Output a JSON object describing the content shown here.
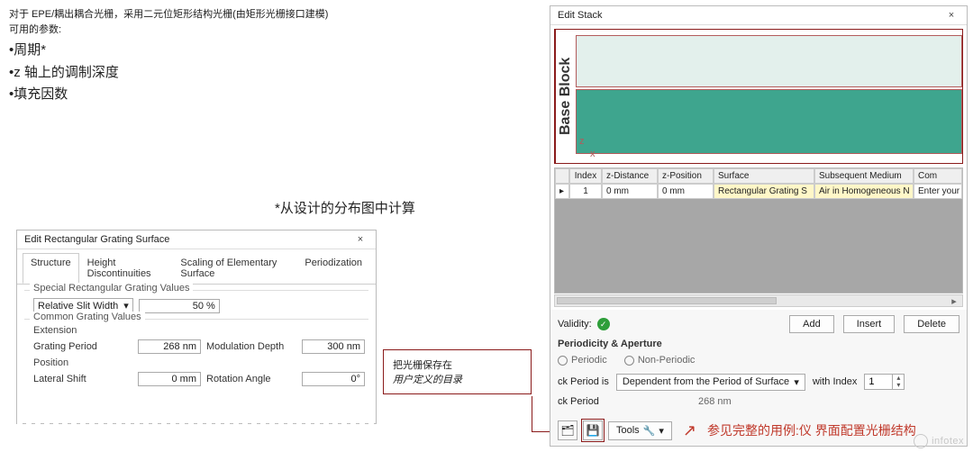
{
  "desc": {
    "p1": "对于 EPE/耦出耦合光栅，采用二元位矩形结构光栅(由矩形光栅接口建模)",
    "p2": "可用的参数:",
    "b1": "•周期*",
    "b2": "•z 轴上的调制深度",
    "b3": "•填充因数",
    "asterisk": "*从设计的分布图中计算"
  },
  "ergs": {
    "title": "Edit Rectangular Grating Surface",
    "close": "×",
    "tabs": {
      "structure": "Structure",
      "height": "Height Discontinuities",
      "scaling": "Scaling of Elementary Surface",
      "period": "Periodization"
    },
    "grp_special": "Special Rectangular Grating Values",
    "rel_slit_label": "Relative Slit Width",
    "rel_slit_val": "50 %",
    "grp_common": "Common Grating Values",
    "sub_ext": "Extension",
    "grating_period_label": "Grating Period",
    "grating_period_val": "268 nm",
    "mod_depth_label": "Modulation Depth",
    "mod_depth_val": "300 nm",
    "sub_pos": "Position",
    "lat_shift_label": "Lateral Shift",
    "lat_shift_val": "0 mm",
    "rot_angle_label": "Rotation Angle",
    "rot_angle_val": "0°"
  },
  "callout": {
    "l1": "把光栅保存在",
    "l2": "用户定义的目录"
  },
  "stack": {
    "title": "Edit Stack",
    "close": "×",
    "block_label": "Base Block",
    "axis_x": "x",
    "axis_z": "z",
    "grid": {
      "h_mark": "",
      "h_index": "Index",
      "h_zd": "z-Distance",
      "h_zp": "z-Position",
      "h_surf": "Surface",
      "h_med": "Subsequent Medium",
      "h_com": "Com",
      "r_mark": "▸",
      "r_index": "1",
      "r_zd": "0 mm",
      "r_zp": "0 mm",
      "r_surf": "Rectangular Grating S",
      "r_med": "Air in Homogeneous N",
      "r_com": "Enter your commen"
    },
    "validity": "Validity:",
    "ok": "✓",
    "btn_add": "Add",
    "btn_insert": "Insert",
    "btn_delete": "Delete",
    "section": "Periodicity & Aperture",
    "radio_p": "Periodic",
    "radio_np": "Non-Periodic",
    "per_is_label": "ck Period is",
    "per_is_val": "Dependent from the Period of Surface",
    "with_index": "with Index",
    "index_val": "1",
    "per_label": "ck Period",
    "per_val": "268 nm",
    "tools": "Tools",
    "link": "参见完整的用例:仪     界面配置光栅结构"
  },
  "watermark": "infotex"
}
